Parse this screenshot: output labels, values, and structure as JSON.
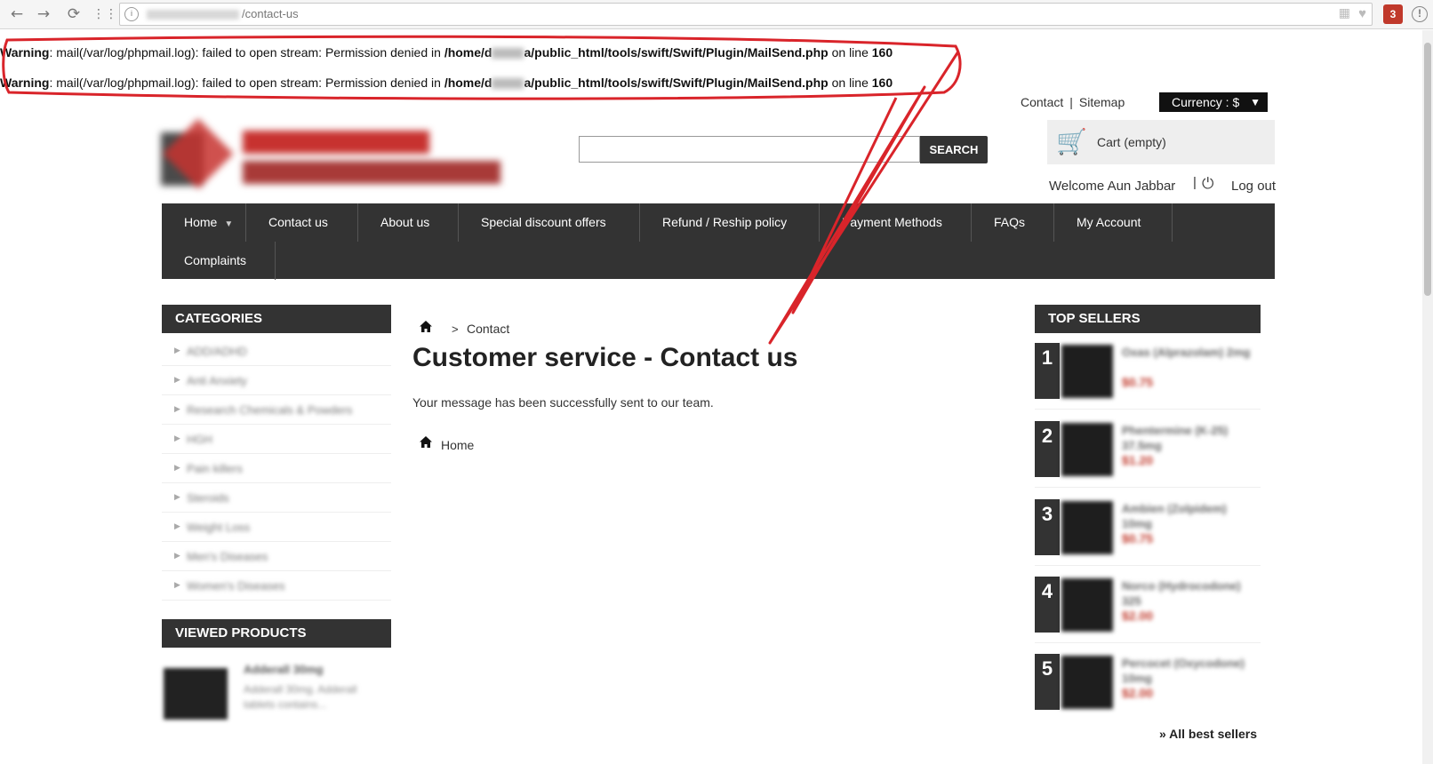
{
  "browser": {
    "url_path": "/contact-us",
    "icons": [
      "back-icon",
      "forward-icon",
      "reload-icon",
      "apps-icon",
      "bookmark-icon",
      "extension-icon",
      "menu-icon"
    ],
    "extension_badge": "3"
  },
  "warnings": [
    {
      "label": "Warning",
      "message": ": mail(/var/log/phpmail.log): failed to open stream: Permission denied in ",
      "path_prefix": "/home/d",
      "path_suffix": "a/public_html/tools/swift/Swift/Plugin/MailSend.php",
      "line_text": " on line ",
      "line": "160"
    },
    {
      "label": "Warning",
      "message": ": mail(/var/log/phpmail.log): failed to open stream: Permission denied in ",
      "path_prefix": "/home/d",
      "path_suffix": "a/public_html/tools/swift/Swift/Plugin/MailSend.php",
      "line_text": " on line ",
      "line": "160"
    }
  ],
  "header": {
    "contact_link": "Contact",
    "link_separator": "|",
    "sitemap_link": "Sitemap",
    "currency_label": "Currency : $",
    "currency_arrow": "▼",
    "search_placeholder": "",
    "search_button": "SEARCH",
    "cart_label": "Cart (empty)",
    "welcome": "Welcome Aun Jabbar",
    "welcome_separator": "|",
    "logout": "Log out"
  },
  "nav": {
    "items": [
      "Home",
      "Contact us",
      "About us",
      "Special discount offers",
      "Refund / Reship policy",
      "Payment Methods",
      "FAQs",
      "My Account",
      "Complaints"
    ]
  },
  "sidebar": {
    "categories_title": "CATEGORIES",
    "categories": [
      "ADD/ADHD",
      "Anti Anxiety",
      "Research Chemicals & Powders",
      "HGH",
      "Pain killers",
      "Steroids",
      "Weight Loss",
      "Men's Diseases",
      "Women's Diseases"
    ],
    "viewed_title": "VIEWED PRODUCTS",
    "viewed_item": {
      "name": "Adderall 30mg",
      "desc": "Adderall 30mg. Adderall tablets contains..."
    }
  },
  "main": {
    "breadcrumb_sep": ">",
    "breadcrumb_current": "Contact",
    "title": "Customer service - Contact us",
    "message": "Your message has been successfully sent to our team.",
    "home_link": "Home"
  },
  "top_sellers": {
    "title": "TOP SELLERS",
    "items": [
      {
        "rank": "1",
        "name": "Oxas (Alprazolam) 2mg",
        "price": "$0.75"
      },
      {
        "rank": "2",
        "name": "Phentermine (K-25) 37.5mg",
        "price": "$1.20"
      },
      {
        "rank": "3",
        "name": "Ambien (Zolpidem) 10mg",
        "price": "$0.75"
      },
      {
        "rank": "4",
        "name": "Norco (Hydrocodone) 325",
        "price": "$2.00"
      },
      {
        "rank": "5",
        "name": "Percocet (Oxycodone) 10mg",
        "price": "$2.00"
      }
    ],
    "all_link": "» All best sellers"
  }
}
